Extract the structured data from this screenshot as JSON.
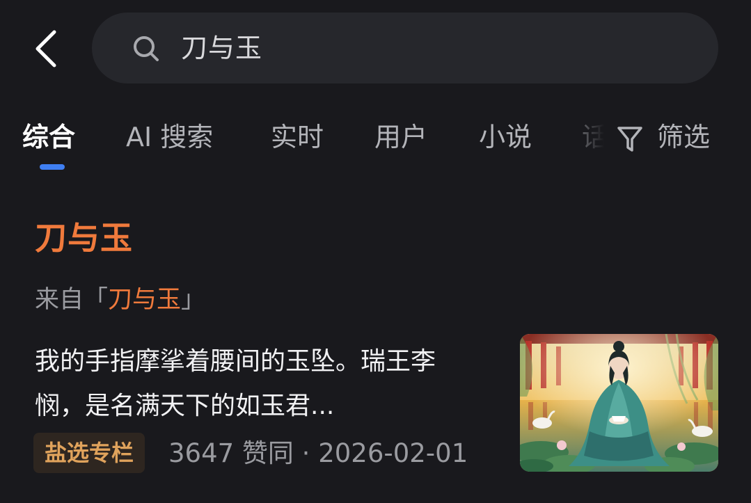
{
  "header": {
    "back_icon": "chevron-left-icon",
    "search": {
      "icon": "search-icon",
      "query": "刀与玉"
    }
  },
  "tabs": [
    {
      "label": "综合",
      "active": true
    },
    {
      "label": "AI 搜索",
      "active": false
    },
    {
      "label": "实时",
      "active": false
    },
    {
      "label": "用户",
      "active": false
    },
    {
      "label": "小说",
      "active": false
    },
    {
      "label": "话",
      "active": false
    }
  ],
  "filter": {
    "icon": "funnel-icon",
    "label": "筛选"
  },
  "result": {
    "title": "刀与玉",
    "source_prefix": "来自「",
    "source_name": "刀与玉",
    "source_suffix": "」",
    "snippet": "我的手指摩挲着腰间的玉坠。瑞王李悯，是名满天下的如玉君...",
    "badge": "盐选专栏",
    "stats": "3647 赞同 · 2026-02-01",
    "thumbnail": "illustration-woman-in-palace-courtyard"
  },
  "colors": {
    "background": "#19191d",
    "search_bg": "#26272c",
    "accent_orange": "#f07a3c",
    "tab_indicator": "#3f7ff2",
    "badge_text": "#e0a35c",
    "muted_text": "#9a9ba0"
  }
}
